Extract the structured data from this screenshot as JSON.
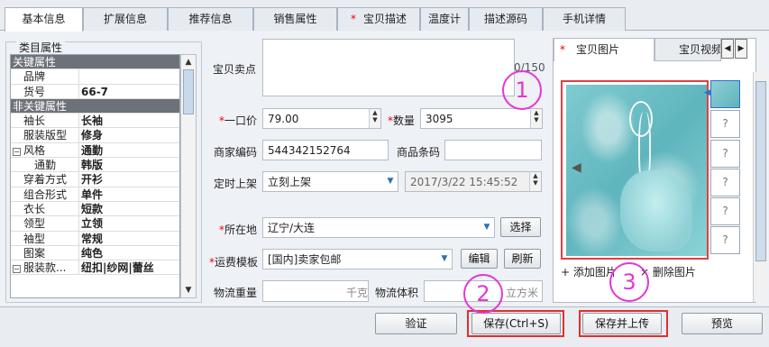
{
  "tabs": [
    {
      "label": "基本信息",
      "required": false
    },
    {
      "label": "扩展信息",
      "required": false
    },
    {
      "label": "推荐信息",
      "required": false
    },
    {
      "label": "销售属性",
      "required": false
    },
    {
      "label": "宝贝描述",
      "required": true
    },
    {
      "label": "温度计",
      "required": false
    },
    {
      "label": "描述源码",
      "required": false
    },
    {
      "label": "手机详情",
      "required": false
    }
  ],
  "required_mark": "*",
  "attrs": {
    "group_title": "类目属性",
    "key_section": "关键属性",
    "nonkey_section": "非关键属性",
    "rows": [
      {
        "name": "品牌",
        "value": ""
      },
      {
        "name": "货号",
        "value": "66-7"
      },
      {
        "name": "袖长",
        "value": "长袖"
      },
      {
        "name": "服装版型",
        "value": "修身"
      },
      {
        "name": "风格",
        "value": "通勤"
      },
      {
        "name": "通勤",
        "value": "韩版"
      },
      {
        "name": "穿着方式",
        "value": "开衫"
      },
      {
        "name": "组合形式",
        "value": "单件"
      },
      {
        "name": "衣长",
        "value": "短款"
      },
      {
        "name": "领型",
        "value": "立领"
      },
      {
        "name": "袖型",
        "value": "常规"
      },
      {
        "name": "图案",
        "value": "纯色"
      },
      {
        "name": "服装款...",
        "value": "纽扣|纱网|蕾丝"
      }
    ],
    "expander": "−"
  },
  "form": {
    "selling_point_label": "宝贝卖点",
    "selling_point_count": "0/150",
    "price_label": "一口价",
    "price_value": "79.00",
    "quantity_label": "数量",
    "quantity_value": "3095",
    "merchant_code_label": "商家编码",
    "merchant_code_value": "544342152764",
    "barcode_label": "商品条码",
    "barcode_value": "",
    "schedule_label": "定时上架",
    "schedule_value": "立刻上架",
    "schedule_time": "2017/3/22 15:45:52",
    "location_label": "所在地",
    "location_value": "辽宁/大连",
    "location_button": "选择",
    "shipping_label": "运费模板",
    "shipping_value": "[国内]卖家包邮",
    "shipping_edit": "编辑",
    "shipping_refresh": "刷新",
    "weight_label": "物流重量",
    "weight_unit": "千克",
    "volume_label": "物流体积",
    "volume_unit": "立方米"
  },
  "images": {
    "tab_main": "宝贝图片",
    "tab_video": "宝贝视频",
    "placeholder": "?",
    "add_label": "+ 添加图片",
    "remove_label": "× 删除图片"
  },
  "buttons": {
    "verify": "验证",
    "save": "保存(Ctrl+S)",
    "save_upload": "保存并上传",
    "preview": "预览"
  },
  "annotations": [
    "1",
    "2",
    "3"
  ],
  "colors": {
    "highlight": "#e03030",
    "annotation": "#e236d8",
    "section": "#6d7178"
  }
}
